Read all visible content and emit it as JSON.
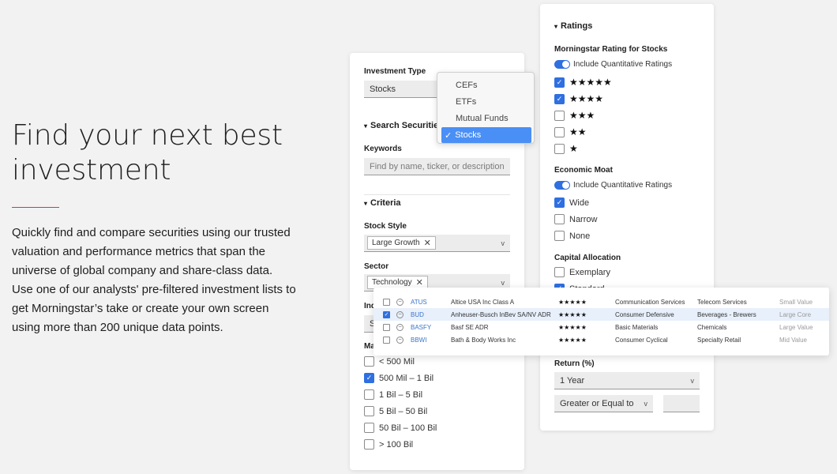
{
  "hero": {
    "title": "Find your next best investment",
    "body": "Quickly find and compare securities using our trusted valuation and performance metrics that span the universe of global company and share-class data. Use one of our analysts' pre-filtered investment lists to get Morningstar’s take or create your own screen using more than 200 unique data points."
  },
  "left": {
    "investment_type_label": "Investment Type",
    "investment_type_value": "Stocks",
    "search_section": "Search Securities",
    "keywords_label": "Keywords",
    "keywords_placeholder": "Find by name, ticker, or description",
    "criteria_section": "Criteria",
    "stock_style_label": "Stock Style",
    "stock_style_chip": "Large Growth",
    "sector_label": "Sector",
    "sector_chip": "Technology",
    "industry_label_partial": "Ind",
    "industry_value_partial": "S",
    "market_cap_label_partial": "Ma",
    "market_caps": [
      {
        "label": "< 500 Mil",
        "checked": false
      },
      {
        "label": "500 Mil – 1 Bil",
        "checked": true
      },
      {
        "label": "1 Bil – 5 Bil",
        "checked": false
      },
      {
        "label": "5 Bil – 50 Bil",
        "checked": false
      },
      {
        "label": "50 Bil – 100 Bil",
        "checked": false
      },
      {
        "label": "> 100 Bil",
        "checked": false
      }
    ]
  },
  "dropdown": {
    "options": [
      "CEFs",
      "ETFs",
      "Mutual Funds",
      "Stocks"
    ],
    "selected": "Stocks",
    "check_glyph": "✓"
  },
  "right": {
    "ratings_section": "Ratings",
    "rating_label": "Morningstar Rating for Stocks",
    "include_quant": "Include Quantitative Ratings",
    "star_rows": [
      {
        "stars": "★★★★★",
        "checked": true
      },
      {
        "stars": "★★★★",
        "checked": true
      },
      {
        "stars": "★★★",
        "checked": false
      },
      {
        "stars": "★★",
        "checked": false
      },
      {
        "stars": "★",
        "checked": false
      }
    ],
    "moat_label": "Economic Moat",
    "moat_include_quant": "Include Quantitative Ratings",
    "moat_options": [
      {
        "label": "Wide",
        "checked": true
      },
      {
        "label": "Narrow",
        "checked": false
      },
      {
        "label": "None",
        "checked": false
      }
    ],
    "capital_label": "Capital Allocation",
    "capital_options": [
      {
        "label": "Exemplary",
        "checked": false
      },
      {
        "label": "Standard",
        "checked": true
      }
    ],
    "return_label": "Return (%)",
    "return_period": "1 Year",
    "comparison": "Greater or Equal to"
  },
  "results": [
    {
      "ticker": "ATUS",
      "name": "Altice USA Inc Class A",
      "stars": "★★★★★",
      "sector": "Communication Services",
      "industry": "Telecom Services",
      "style": "Small Value",
      "checked": false,
      "highlight": false
    },
    {
      "ticker": "BUD",
      "name": "Anheuser-Busch InBev SA/NV ADR",
      "stars": "★★★★★",
      "sector": "Consumer Defensive",
      "industry": "Beverages - Brewers",
      "style": "Large Core",
      "checked": true,
      "highlight": true
    },
    {
      "ticker": "BASFY",
      "name": "Basf SE ADR",
      "stars": "★★★★★",
      "sector": "Basic Materials",
      "industry": "Chemicals",
      "style": "Large Value",
      "checked": false,
      "highlight": false
    },
    {
      "ticker": "BBWI",
      "name": "Bath & Body Works Inc",
      "stars": "★★★★★",
      "sector": "Consumer Cyclical",
      "industry": "Specialty Retail",
      "style": "Mid Value",
      "checked": false,
      "highlight": false
    }
  ],
  "glyphs": {
    "check": "✓",
    "chevron": "v",
    "triangle": "▾",
    "close": "✕",
    "minus": "−"
  }
}
